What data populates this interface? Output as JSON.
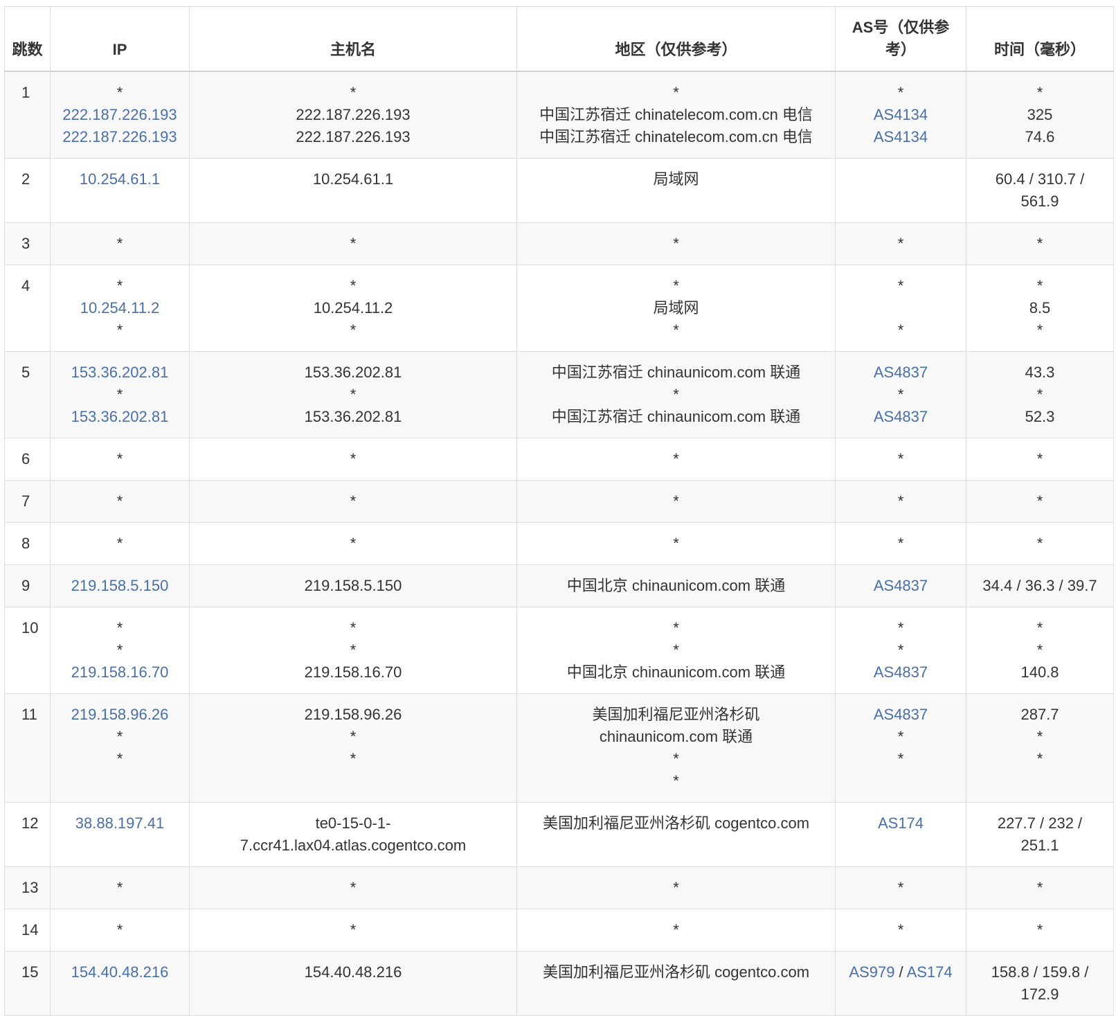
{
  "headers": {
    "hop": "跳数",
    "ip": "IP",
    "host": "主机名",
    "region": "地区（仅供参考）",
    "as": "AS号（仅供参考）",
    "time": "时间（毫秒）"
  },
  "rows": [
    {
      "hop": "1",
      "ip": [
        "*",
        "222.187.226.193",
        "222.187.226.193"
      ],
      "host": [
        "*",
        "222.187.226.193",
        "222.187.226.193"
      ],
      "region": [
        "*",
        "中国江苏宿迁 chinatelecom.com.cn 电信",
        "中国江苏宿迁 chinatelecom.com.cn 电信"
      ],
      "as": [
        "*",
        "AS4134",
        "AS4134"
      ],
      "time": [
        "*",
        "325",
        "74.6"
      ]
    },
    {
      "hop": "2",
      "ip": [
        "10.254.61.1"
      ],
      "host": [
        "10.254.61.1"
      ],
      "region": [
        "局域网"
      ],
      "as": [],
      "time": [
        "60.4 / 310.7 /",
        "561.9"
      ]
    },
    {
      "hop": "3",
      "ip": [
        "*"
      ],
      "host": [
        "*"
      ],
      "region": [
        "*"
      ],
      "as": [
        "*"
      ],
      "time": [
        "*"
      ]
    },
    {
      "hop": "4",
      "ip": [
        "*",
        "10.254.11.2",
        "*"
      ],
      "host": [
        "*",
        "10.254.11.2",
        "*"
      ],
      "region": [
        "*",
        "局域网",
        "*"
      ],
      "as": [
        "*",
        "",
        "*"
      ],
      "time": [
        "*",
        "8.5",
        "*"
      ]
    },
    {
      "hop": "5",
      "ip": [
        "153.36.202.81",
        "*",
        "153.36.202.81"
      ],
      "host": [
        "153.36.202.81",
        "*",
        "153.36.202.81"
      ],
      "region": [
        "中国江苏宿迁 chinaunicom.com 联通",
        "*",
        "中国江苏宿迁 chinaunicom.com 联通"
      ],
      "as": [
        "AS4837",
        "*",
        "AS4837"
      ],
      "time": [
        "43.3",
        "*",
        "52.3"
      ]
    },
    {
      "hop": "6",
      "ip": [
        "*"
      ],
      "host": [
        "*"
      ],
      "region": [
        "*"
      ],
      "as": [
        "*"
      ],
      "time": [
        "*"
      ]
    },
    {
      "hop": "7",
      "ip": [
        "*"
      ],
      "host": [
        "*"
      ],
      "region": [
        "*"
      ],
      "as": [
        "*"
      ],
      "time": [
        "*"
      ]
    },
    {
      "hop": "8",
      "ip": [
        "*"
      ],
      "host": [
        "*"
      ],
      "region": [
        "*"
      ],
      "as": [
        "*"
      ],
      "time": [
        "*"
      ]
    },
    {
      "hop": "9",
      "ip": [
        "219.158.5.150"
      ],
      "host": [
        "219.158.5.150"
      ],
      "region": [
        "中国北京 chinaunicom.com 联通"
      ],
      "as": [
        "AS4837"
      ],
      "time": [
        "34.4 / 36.3 / 39.7"
      ]
    },
    {
      "hop": "10",
      "ip": [
        "*",
        "*",
        "219.158.16.70"
      ],
      "host": [
        "*",
        "*",
        "219.158.16.70"
      ],
      "region": [
        "*",
        "*",
        "中国北京 chinaunicom.com 联通"
      ],
      "as": [
        "*",
        "*",
        "AS4837"
      ],
      "time": [
        "*",
        "*",
        "140.8"
      ]
    },
    {
      "hop": "11",
      "ip": [
        "219.158.96.26",
        "*",
        "*"
      ],
      "host": [
        "219.158.96.26",
        "*",
        "*"
      ],
      "region": [
        "美国加利福尼亚州洛杉矶",
        "chinaunicom.com 联通",
        "*",
        "*"
      ],
      "as": [
        "AS4837",
        "*",
        "*"
      ],
      "time": [
        "287.7",
        "*",
        "*"
      ]
    },
    {
      "hop": "12",
      "ip": [
        "38.88.197.41"
      ],
      "host": [
        "te0-15-0-1-",
        "7.ccr41.lax04.atlas.cogentco.com"
      ],
      "region": [
        "美国加利福尼亚州洛杉矶 cogentco.com"
      ],
      "as": [
        "AS174"
      ],
      "time": [
        "227.7 / 232 /",
        "251.1"
      ]
    },
    {
      "hop": "13",
      "ip": [
        "*"
      ],
      "host": [
        "*"
      ],
      "region": [
        "*"
      ],
      "as": [
        "*"
      ],
      "time": [
        "*"
      ]
    },
    {
      "hop": "14",
      "ip": [
        "*"
      ],
      "host": [
        "*"
      ],
      "region": [
        "*"
      ],
      "as": [
        "*"
      ],
      "time": [
        "*"
      ]
    },
    {
      "hop": "15",
      "ip": [
        "154.40.48.216"
      ],
      "host": [
        "154.40.48.216"
      ],
      "region": [
        "美国加利福尼亚州洛杉矶 cogentco.com"
      ],
      "as": [
        "AS979 / AS174"
      ],
      "time": [
        "158.8 / 159.8 /",
        "172.9"
      ]
    }
  ],
  "colors": {
    "link": "#4a6fa5",
    "text": "#333333",
    "stripe": "#f8f8f8",
    "border": "#dcdcdc"
  }
}
